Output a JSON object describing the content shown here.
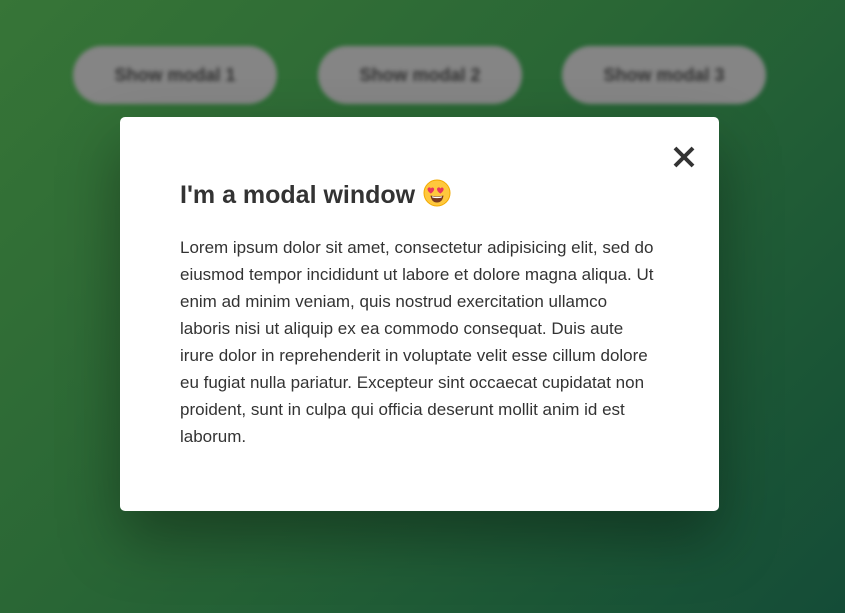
{
  "buttons": [
    {
      "label": "Show modal 1"
    },
    {
      "label": "Show modal 2"
    },
    {
      "label": "Show modal 3"
    }
  ],
  "modal": {
    "title": "I'm a modal window",
    "emoji_icon": "heart-eyes-emoji-icon",
    "close_icon": "close-icon",
    "body": "Lorem ipsum dolor sit amet, consectetur adipisicing elit, sed do eiusmod tempor incididunt ut labore et dolore magna aliqua. Ut enim ad minim veniam, quis nostrud exercitation ullamco laboris nisi ut aliquip ex ea commodo consequat. Duis aute irure dolor in reprehenderit in voluptate velit esse cillum dolore eu fugiat nulla pariatur. Excepteur sint occaecat cupidatat non proident, sunt in culpa qui officia deserunt mollit anim id est laborum."
  },
  "colors": {
    "background_start": "#3a7a3a",
    "background_end": "#15503a",
    "button_bg": "#8b8b8b",
    "text": "#333333",
    "modal_bg": "#ffffff"
  }
}
